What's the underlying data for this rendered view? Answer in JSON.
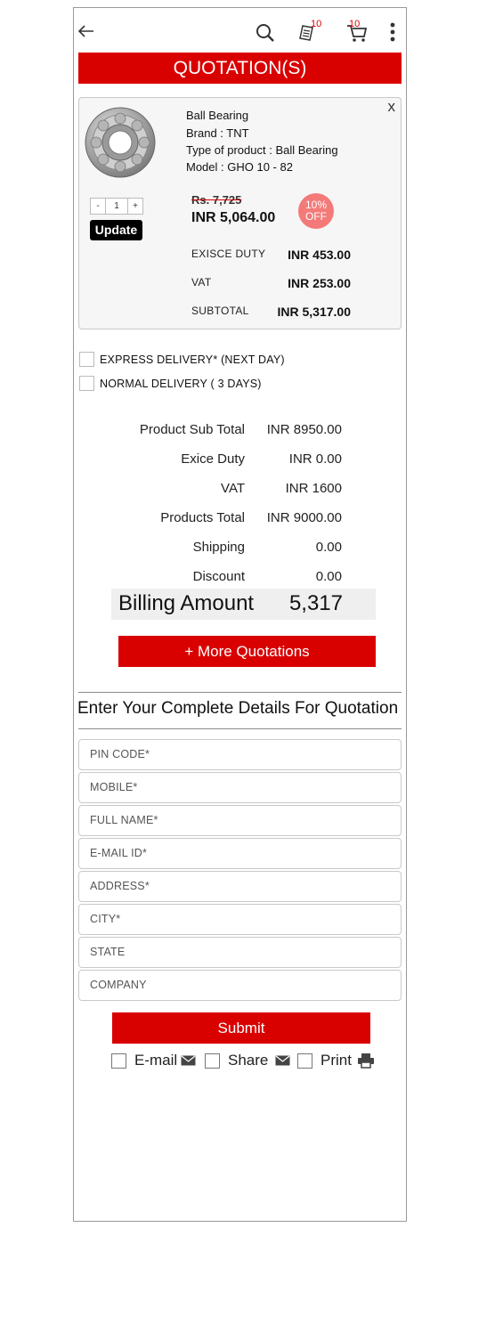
{
  "header": {
    "quote_count": "10",
    "cart_count": "10",
    "title": "QUOTATION(S)"
  },
  "product": {
    "name": "Ball Bearing",
    "brand": "Brand : TNT",
    "type": "Type of product : Ball Bearing",
    "model": "Model : GHO 10 - 82",
    "close": "x",
    "qty_minus": "-",
    "qty_value": "1",
    "qty_plus": "+",
    "update_label": "Update",
    "old_price": "Rs. 7,725",
    "new_price": "INR 5,064.00",
    "discount_pct": "10%",
    "discount_word": "OFF",
    "rows": [
      {
        "label": "EXISCE DUTY",
        "value": "INR 453.00"
      },
      {
        "label": "VAT",
        "value": "INR 253.00"
      },
      {
        "label": "SUBTOTAL",
        "value": "INR 5,317.00"
      }
    ]
  },
  "delivery": {
    "express": "EXPRESS DELIVERY* (NEXT DAY)",
    "normal": "NORMAL DELIVERY ( 3 DAYS)"
  },
  "totals": [
    {
      "label": "Product Sub Total",
      "value": "INR 8950.00"
    },
    {
      "label": "Exice Duty",
      "value": "INR 0.00"
    },
    {
      "label": "VAT",
      "value": "INR 1600"
    },
    {
      "label": "Products Total",
      "value": "INR 9000.00"
    },
    {
      "label": "Shipping",
      "value": "0.00"
    },
    {
      "label": "Discount",
      "value": "0.00"
    }
  ],
  "billing": {
    "label": "Billing Amount",
    "value": "5,317"
  },
  "more_quotations": "+ More Quotations",
  "details_heading": "Enter Your Complete Details For Quotation",
  "form": {
    "pin": "PIN CODE*",
    "mobile": "MOBILE*",
    "full_name": "FULL NAME*",
    "email": "E-MAIL ID*",
    "address": "ADDRESS*",
    "city": "CITY*",
    "state": "STATE",
    "company": "COMPANY"
  },
  "submit": "Submit",
  "options": {
    "email": "E-mail",
    "share": "Share",
    "print": "Print"
  },
  "colors": {
    "accent": "#d90000",
    "badge": "#f37a78"
  }
}
